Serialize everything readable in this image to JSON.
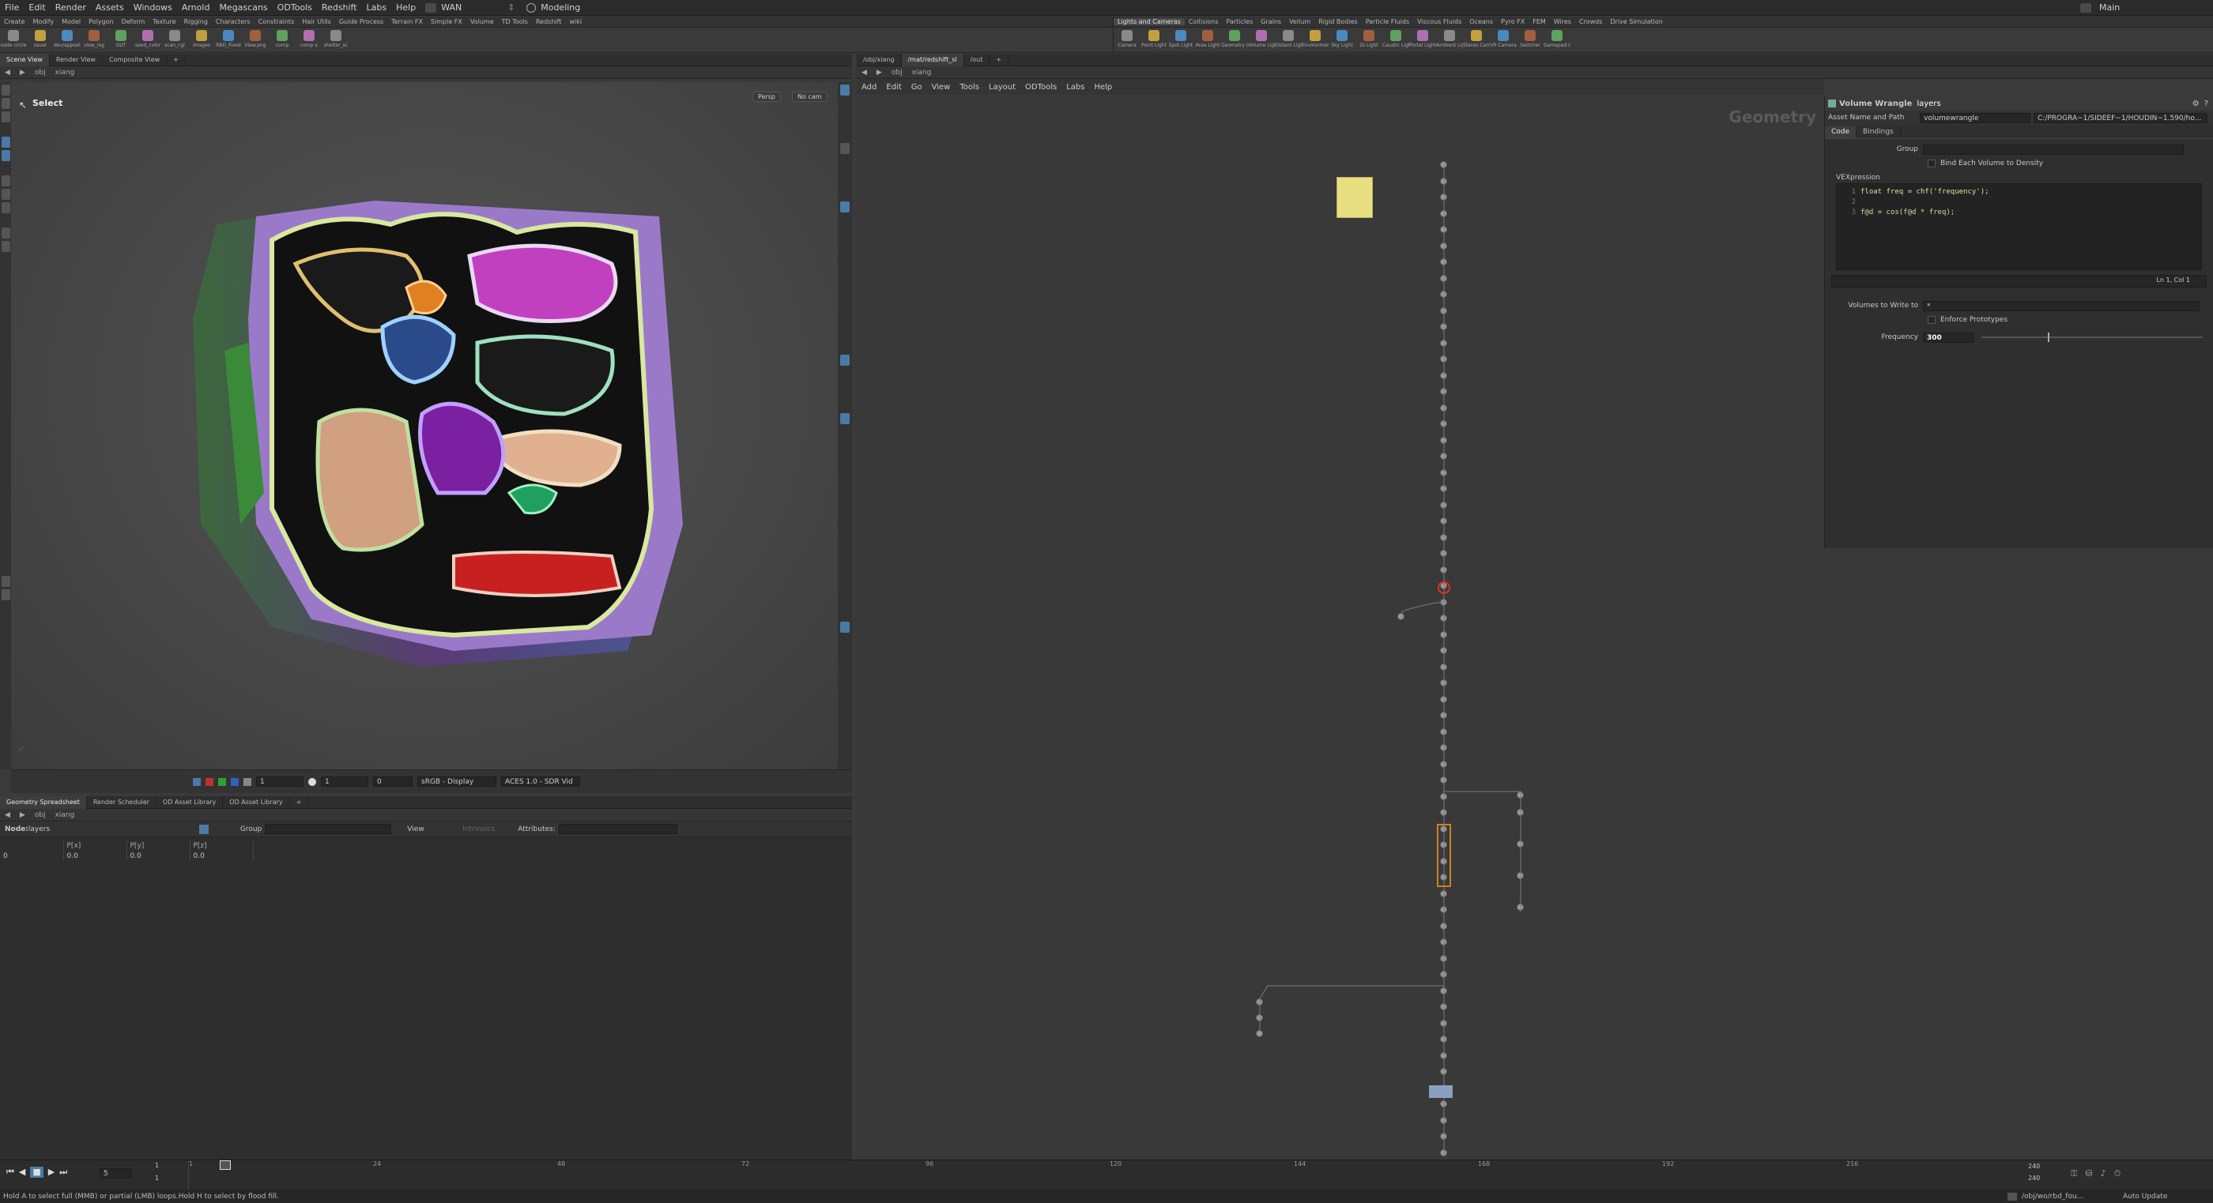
{
  "menubar": {
    "items": [
      "File",
      "Edit",
      "Render",
      "Assets",
      "Windows",
      "Arnold",
      "Megascans",
      "ODTools",
      "Redshift",
      "Labs",
      "Help"
    ],
    "desktop": "WAN",
    "mode": "Modeling",
    "workspace": "Main"
  },
  "shelf_left": {
    "tabs": [
      "Create",
      "Modify",
      "Model",
      "Polygon",
      "Deform",
      "Texture",
      "Rigging",
      "Characters",
      "Constraints",
      "Hair Utils",
      "Guide Process",
      "Terrain FX",
      "Simple FX",
      "Volume",
      "TD Tools",
      "Redshift",
      "wiki"
    ],
    "tools": [
      "node circle",
      "saver",
      "dev/appsetti",
      "view_log",
      "OUT",
      "seed_color",
      "scan_cgl",
      "images",
      "RBD_Fixed",
      "View.png",
      "comp",
      "comp x",
      "shelter_sc"
    ]
  },
  "shelf_right": {
    "tabs": [
      "Lights and Cameras",
      "Collisions",
      "Particles",
      "Grains",
      "Vellum",
      "Rigid Bodies",
      "Particle Fluids",
      "Viscous Fluids",
      "Oceans",
      "Pyro FX",
      "FEM",
      "Wires",
      "Crowds",
      "Drive Simulation"
    ],
    "tools": [
      "Camera",
      "Point Light",
      "Spot Light",
      "Area Light",
      "Geometry Light",
      "Volume Light",
      "Distant Light",
      "Environment Light",
      "Sky Light",
      "GI Light",
      "Caustic Light",
      "Portal Light",
      "Ambient Light",
      "Stereo Camera",
      "VR Camera",
      "Switcher",
      "Gamepad Camera"
    ]
  },
  "scene_tabs": [
    "Scene View",
    "Render View",
    "Composite View"
  ],
  "scene_path": [
    "obj",
    "xiang"
  ],
  "viewport": {
    "tool_label": "Select",
    "camera_menu": "Persp",
    "cam_menu": "No cam",
    "frame_field": "1",
    "gamma_field": "1",
    "exposure_field": "0",
    "display_lut": "sRGB - Display",
    "view_lut": "ACES 1.0 - SDR Vid"
  },
  "network_tabs": [
    "/obj/xiang",
    "/mat/redshift_sl",
    "/out"
  ],
  "network_path": [
    "obj",
    "xiang"
  ],
  "network_menu": [
    "Add",
    "Edit",
    "Go",
    "View",
    "Tools",
    "Layout",
    "ODTools",
    "Labs",
    "Help"
  ],
  "network_context": "Geometry",
  "parameters": {
    "node_type": "Volume Wrangle",
    "node_name": "layers",
    "asset_label": "Asset Name and Path",
    "asset_value": "volumewrangle",
    "asset_path": "C:/PROGRA~1/SIDEEF~1/HOUDIN~1.590/ho...",
    "tabs": [
      "Code",
      "Bindings"
    ],
    "group_label": "Group",
    "bind_density": "Bind Each Volume to Density",
    "vex_label": "VEXpression",
    "code_lines": [
      "float freq = chf('frequency');",
      "",
      "f@d = cos(f@d * freq);"
    ],
    "cursor": "Ln 1, Col 1",
    "volumes_label": "Volumes to Write to",
    "volumes_value": "*",
    "enforce": "Enforce Prototypes",
    "frequency_label": "Frequency",
    "frequency_value": "300",
    "frequency_fraction": 0.3
  },
  "sheet": {
    "tabs": [
      "Geometry Spreadsheet",
      "Render Scheduler",
      "OD Asset Library",
      "OD Asset Library"
    ],
    "path": [
      "obj",
      "xiang"
    ],
    "node_label": "Node:",
    "node_name": "layers",
    "group_label": "Group",
    "view_label": "View",
    "intrinsics_label": "Intrinsics",
    "attributes_label": "Attributes:",
    "columns": [
      "",
      "P[x]",
      "P[y]",
      "P[z]"
    ],
    "rows": [
      [
        "0",
        "0.0",
        "0.0",
        "0.0"
      ]
    ]
  },
  "timeline": {
    "current_frame": "5",
    "start_field": "1",
    "end_field": "1",
    "ticks": [
      "1",
      "24",
      "48",
      "72",
      "96",
      "120",
      "144",
      "168",
      "192",
      "216"
    ],
    "range_end": "240",
    "range_end2": "240"
  },
  "status": {
    "message": "Hold A to select full (MMB) or partial (LMB) loops.Hold H to select by flood fill.",
    "path": "/obj/wo/rbd_fou...",
    "update": "Auto Update"
  }
}
